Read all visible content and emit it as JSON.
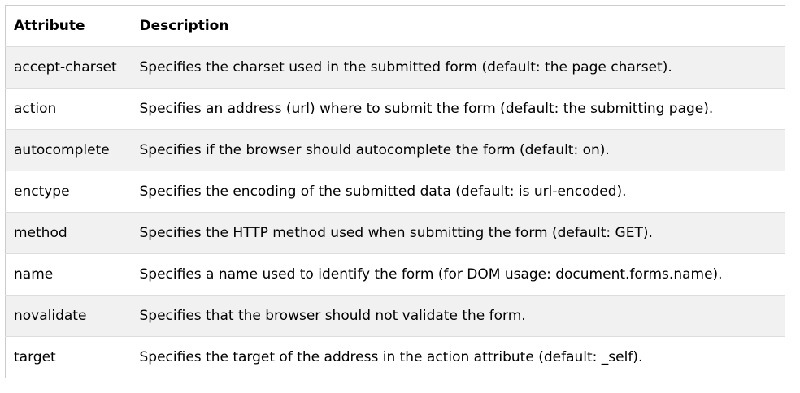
{
  "table": {
    "headers": [
      "Attribute",
      "Description"
    ],
    "rows": [
      [
        "accept-charset",
        "Specifies the charset used in the submitted form (default: the page charset)."
      ],
      [
        "action",
        "Specifies an address (url) where to submit the form (default: the submitting page)."
      ],
      [
        "autocomplete",
        "Specifies if the browser should autocomplete the form (default: on)."
      ],
      [
        "enctype",
        "Specifies the encoding of the submitted data (default: is url-encoded)."
      ],
      [
        "method",
        "Specifies the HTTP method used when submitting the form (default: GET)."
      ],
      [
        "name",
        "Specifies a name used to identify the form (for DOM usage: document.forms.name)."
      ],
      [
        "novalidate",
        "Specifies that the browser should not validate the form."
      ],
      [
        "target",
        "Specifies the target of the address in the action attribute (default: _self)."
      ]
    ]
  }
}
